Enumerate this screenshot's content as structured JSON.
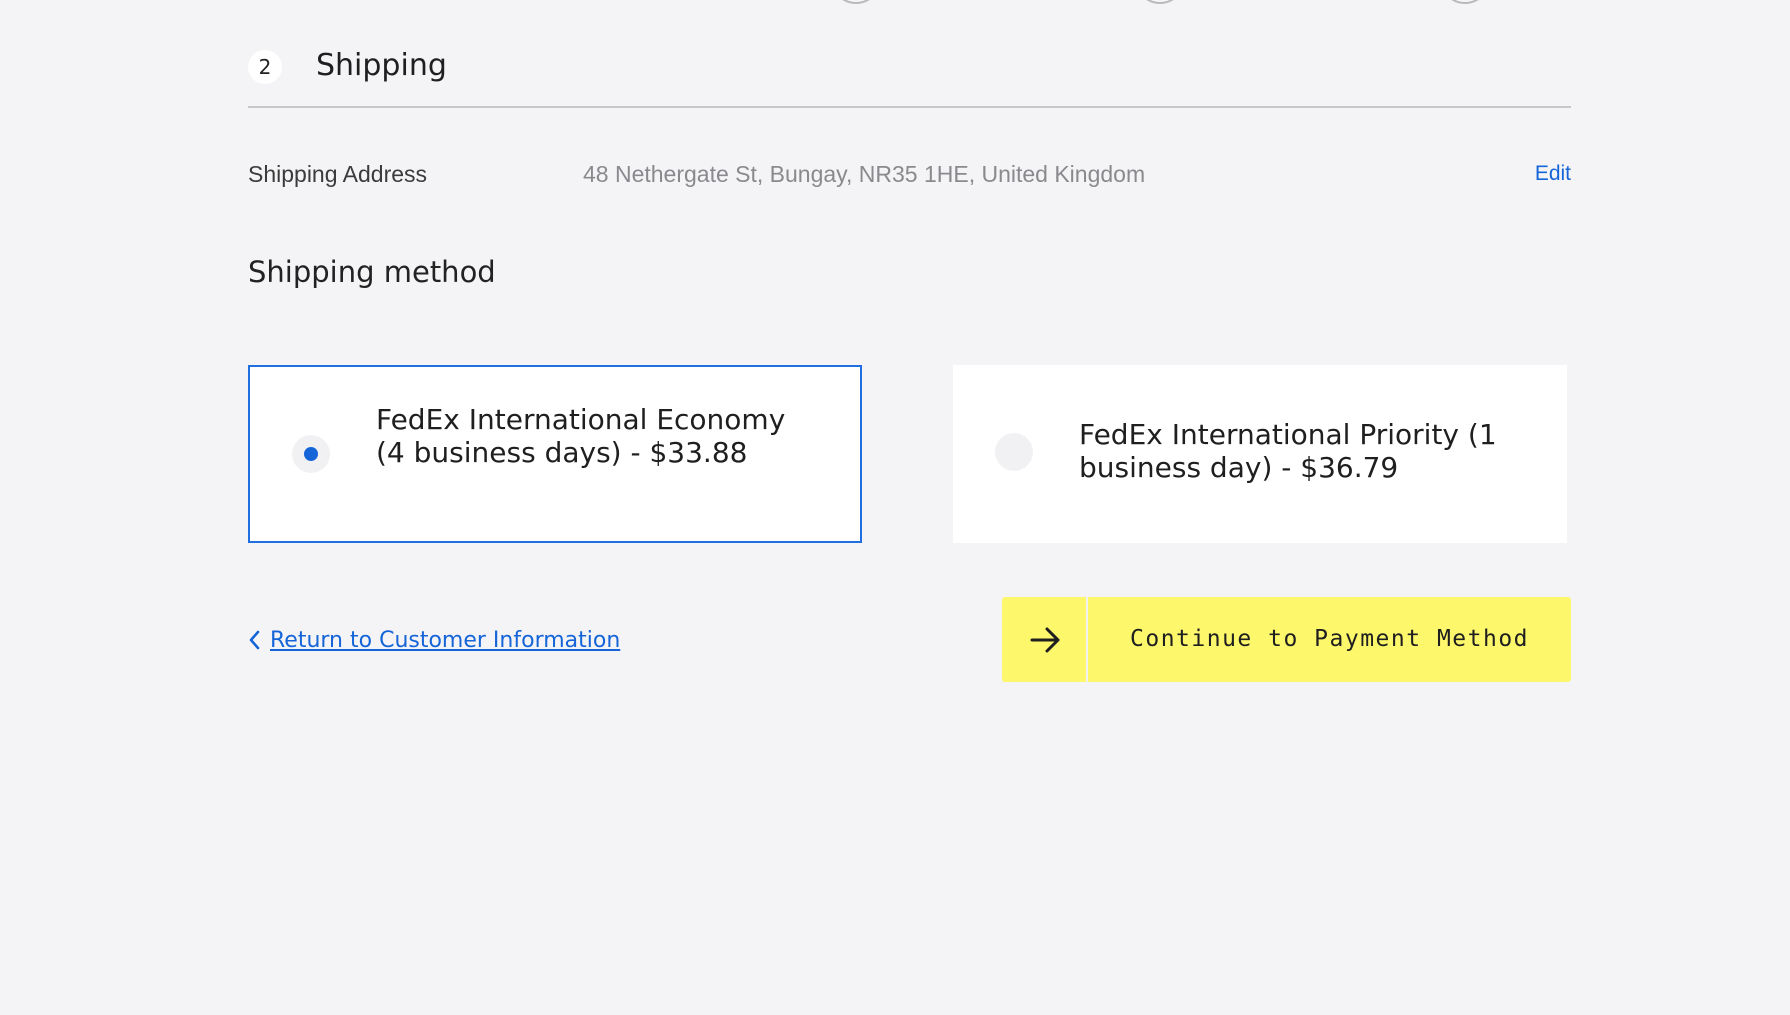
{
  "section": {
    "step_number": "2",
    "title": "Shipping"
  },
  "address": {
    "label": "Shipping Address",
    "value": "48 Nethergate St, Bungay, NR35 1HE, United Kingdom",
    "edit_label": "Edit"
  },
  "shipping_method": {
    "title": "Shipping method",
    "options": [
      {
        "label": "FedEx International Economy (4 business days) - $33.88",
        "selected": true
      },
      {
        "label": "FedEx International Priority (1 business day) - $36.79",
        "selected": false
      }
    ]
  },
  "navigation": {
    "return_label": "Return to Customer Information",
    "continue_label": "Continue to Payment Method"
  },
  "colors": {
    "accent_blue": "#1565d8",
    "button_yellow": "#fdf76c",
    "background": "#f4f4f6"
  },
  "icons": {
    "back": "chevron-left-icon",
    "continue": "arrow-right-icon"
  }
}
